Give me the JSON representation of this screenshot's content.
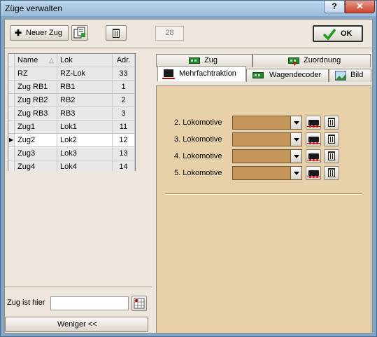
{
  "window": {
    "title": "Züge verwalten",
    "help_glyph": "?",
    "close_glyph": "✕"
  },
  "toolbar": {
    "new_train_label": "Neuer Zug",
    "counter_value": "28",
    "ok_label": "OK"
  },
  "grid": {
    "columns": [
      "Name",
      "Lok",
      "Adr."
    ],
    "rows": [
      {
        "name": "RZ",
        "lok": "RZ-Lok",
        "adr": "33"
      },
      {
        "name": "Zug RB1",
        "lok": "RB1",
        "adr": "1"
      },
      {
        "name": "Zug RB2",
        "lok": "RB2",
        "adr": "2"
      },
      {
        "name": "Zug RB3",
        "lok": "RB3",
        "adr": "3"
      },
      {
        "name": "Zug1",
        "lok": "Lok1",
        "adr": "11"
      },
      {
        "name": "Zug2",
        "lok": "Lok2",
        "adr": "12"
      },
      {
        "name": "Zug3",
        "lok": "Lok3",
        "adr": "13"
      },
      {
        "name": "Zug4",
        "lok": "Lok4",
        "adr": "14"
      }
    ],
    "selected_row": "Zug2"
  },
  "bottom": {
    "zug_ist_hier_label": "Zug ist hier",
    "zug_ist_hier_value": "",
    "weniger_label": "Weniger <<"
  },
  "tabs": {
    "row1": [
      "Zug",
      "Zuordnung"
    ],
    "row2": [
      "Mehrfachtraktion",
      "Wagendecoder",
      "Bild"
    ],
    "active": "Mehrfachtraktion"
  },
  "mehrfachtraktion": {
    "locos": [
      {
        "label": "2. Lokomotive",
        "value": ""
      },
      {
        "label": "3. Lokomotive",
        "value": ""
      },
      {
        "label": "4. Lokomotive",
        "value": ""
      },
      {
        "label": "5. Lokomotive",
        "value": ""
      }
    ]
  },
  "colors": {
    "panel_bg": "#e8d1a9",
    "combo_bg": "#c4965a",
    "client_bg": "#ece6dc",
    "ok_check": "#1e9a1e"
  }
}
